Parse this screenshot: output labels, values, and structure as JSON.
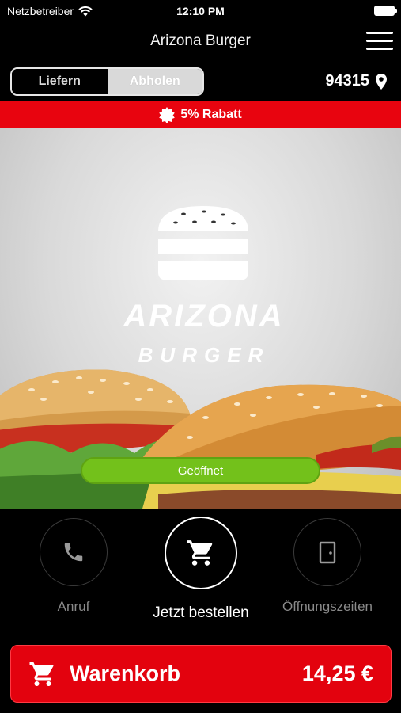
{
  "status_bar": {
    "carrier": "Netzbetreiber",
    "time": "12:10 PM"
  },
  "nav": {
    "title": "Arizona Burger"
  },
  "order_mode": {
    "delivery_label": "Liefern",
    "pickup_label": "Abholen",
    "selected": "pickup"
  },
  "location": {
    "zip": "94315"
  },
  "discount": {
    "label": "5% Rabatt"
  },
  "hero": {
    "brand_name": "ARIZONA",
    "brand_sub": "BURGER",
    "status": "Geöffnet"
  },
  "actions": {
    "call_label": "Anruf",
    "order_label": "Jetzt bestellen",
    "hours_label": "Öffnungszeiten"
  },
  "cart": {
    "label": "Warenkorb",
    "total": "14,25 €"
  },
  "colors": {
    "discount_red": "#e8040f",
    "cart_red": "#e3020e",
    "open_green": "#73c11b"
  }
}
